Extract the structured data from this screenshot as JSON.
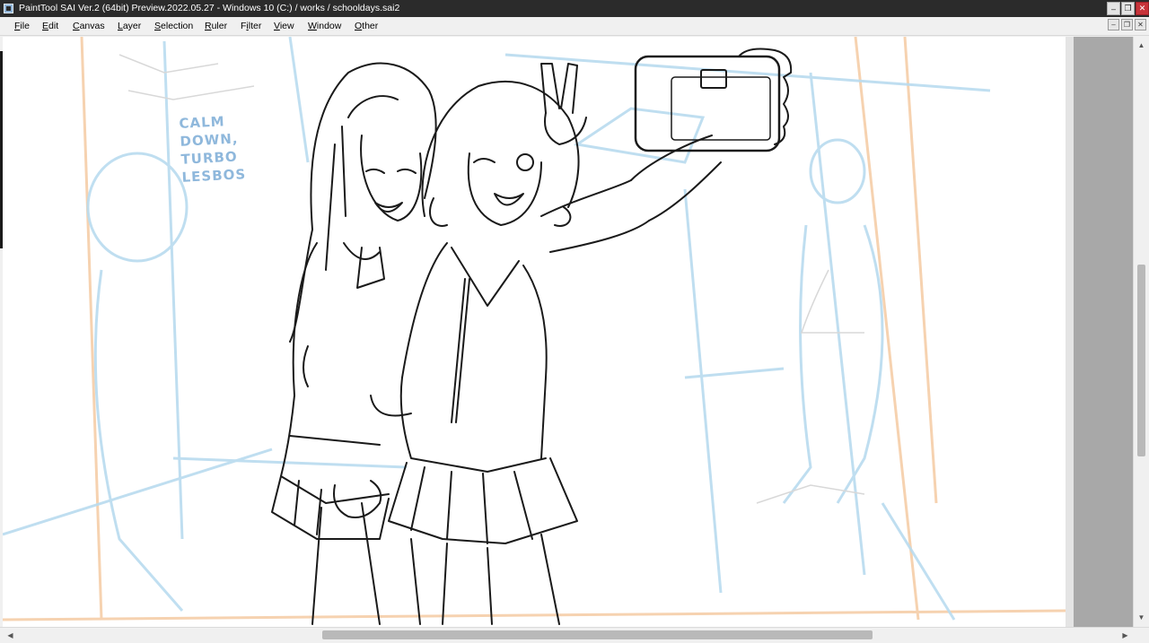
{
  "window": {
    "title": "PaintTool SAI Ver.2 (64bit) Preview.2022.05.27 - Windows 10 (C:) / works / schooldays.sai2",
    "minimize_glyph": "–",
    "restore_glyph": "❐",
    "close_glyph": "✕"
  },
  "menubar": {
    "items": [
      {
        "label": "File",
        "accel": "F",
        "rest": "ile"
      },
      {
        "label": "Edit",
        "accel": "E",
        "rest": "dit"
      },
      {
        "label": "Canvas",
        "accel": "C",
        "rest": "anvas"
      },
      {
        "label": "Layer",
        "accel": "L",
        "rest": "ayer"
      },
      {
        "label": "Selection",
        "accel": "S",
        "rest": "election"
      },
      {
        "label": "Ruler",
        "accel": "R",
        "rest": "uler"
      },
      {
        "label": "Filter",
        "accel": "i",
        "pre": "F",
        "rest": "lter"
      },
      {
        "label": "View",
        "accel": "V",
        "rest": "iew"
      },
      {
        "label": "Window",
        "accel": "W",
        "rest": "indow"
      },
      {
        "label": "Other",
        "accel": "O",
        "rest": "ther"
      }
    ],
    "mdi_minimize": "–",
    "mdi_restore": "❐",
    "mdi_close": "✕"
  },
  "canvas": {
    "sketch_note": "CALM\nDOWN,\nTURBO\nLESBOS",
    "background_color": "#ffffff",
    "lineart_color": "#1a1a1a",
    "sketch_blue": "#a9cfe8",
    "sketch_orange": "#f6d2b0"
  },
  "scrollbars": {
    "up": "▲",
    "down": "▼",
    "left": "◀",
    "right": "▶"
  }
}
